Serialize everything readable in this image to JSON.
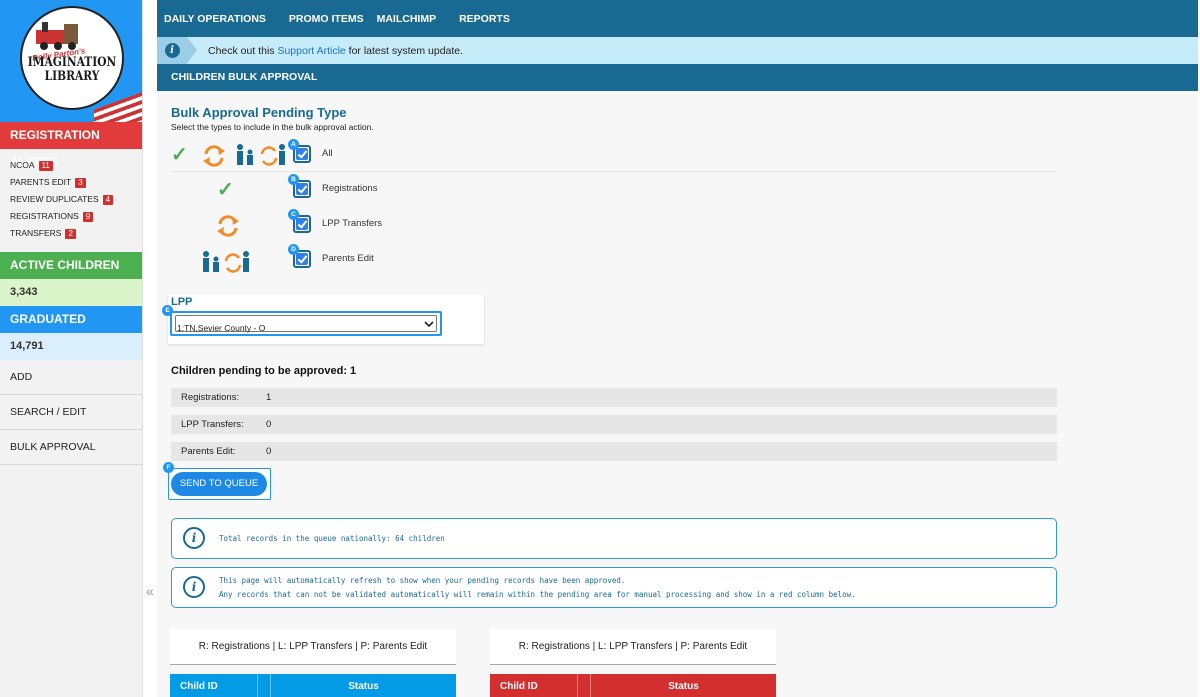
{
  "logo": {
    "script": "Dolly Parton's",
    "line1": "IMAGINATION",
    "line2": "LIBRARY"
  },
  "sidebar": {
    "registration_alerts_title": "REGISTRATION ALERTS",
    "alerts": [
      {
        "label": "NCOA",
        "count": "11"
      },
      {
        "label": "PARENTS EDIT",
        "count": "3"
      },
      {
        "label": "REVIEW DUPLICATES",
        "count": "4"
      },
      {
        "label": "REGISTRATIONS",
        "count": "9"
      },
      {
        "label": "TRANSFERS",
        "count": "2"
      }
    ],
    "active_children_title": "ACTIVE CHILDREN",
    "active_children_value": "3,343",
    "graduated_title": "GRADUATED",
    "graduated_value": "14,791",
    "links": [
      "ADD",
      "SEARCH / EDIT",
      "BULK APPROVAL"
    ],
    "collapse_glyph": "«"
  },
  "nav": {
    "items": [
      "DAILY OPERATIONS",
      "PROMO ITEMS",
      "MAILCHIMP",
      "REPORTS"
    ]
  },
  "support": {
    "prefix": "Check out this ",
    "link": "Support Article",
    "suffix": " for latest system update."
  },
  "section_title": "CHILDREN BULK APPROVAL",
  "bulk": {
    "title": "Bulk Approval Pending Type",
    "subtitle": "Select the types to include in the bulk approval action.",
    "types": [
      {
        "letter": "A",
        "label": "All",
        "checked": true
      },
      {
        "letter": "B",
        "label": "Registrations",
        "checked": true
      },
      {
        "letter": "C",
        "label": "LPP Transfers",
        "checked": true
      },
      {
        "letter": "D",
        "label": "Parents Edit",
        "checked": true
      }
    ]
  },
  "lpp": {
    "label": "LPP",
    "letter": "E",
    "selected": "1:TN,Sevier County - O"
  },
  "pending": {
    "title": "Children pending to be approved: 1",
    "rows": [
      {
        "label": "Registrations:",
        "value": "1"
      },
      {
        "label": "LPP Transfers:",
        "value": "0"
      },
      {
        "label": "Parents Edit:",
        "value": "0"
      }
    ]
  },
  "send": {
    "letter": "F",
    "label": "SEND TO QUEUE"
  },
  "info": {
    "queue_text": "Total records in the queue nationally:  64  children",
    "refresh_line1": "This page will automatically refresh to show when your pending records have been approved.",
    "refresh_line2": "Any records that can not be validated automatically will remain within the pending area for manual processing and show in a red column below."
  },
  "tables": {
    "legend": "R: Registrations | L: LPP Transfers | P: Parents Edit",
    "col_id": "Child ID",
    "col_status": "Status"
  },
  "colors": {
    "nav": "#186a92",
    "accent": "#2196f3",
    "alert": "#e13b3b",
    "active": "#4caf50",
    "pending_table": "#039be5",
    "error_table": "#d32f2f"
  }
}
